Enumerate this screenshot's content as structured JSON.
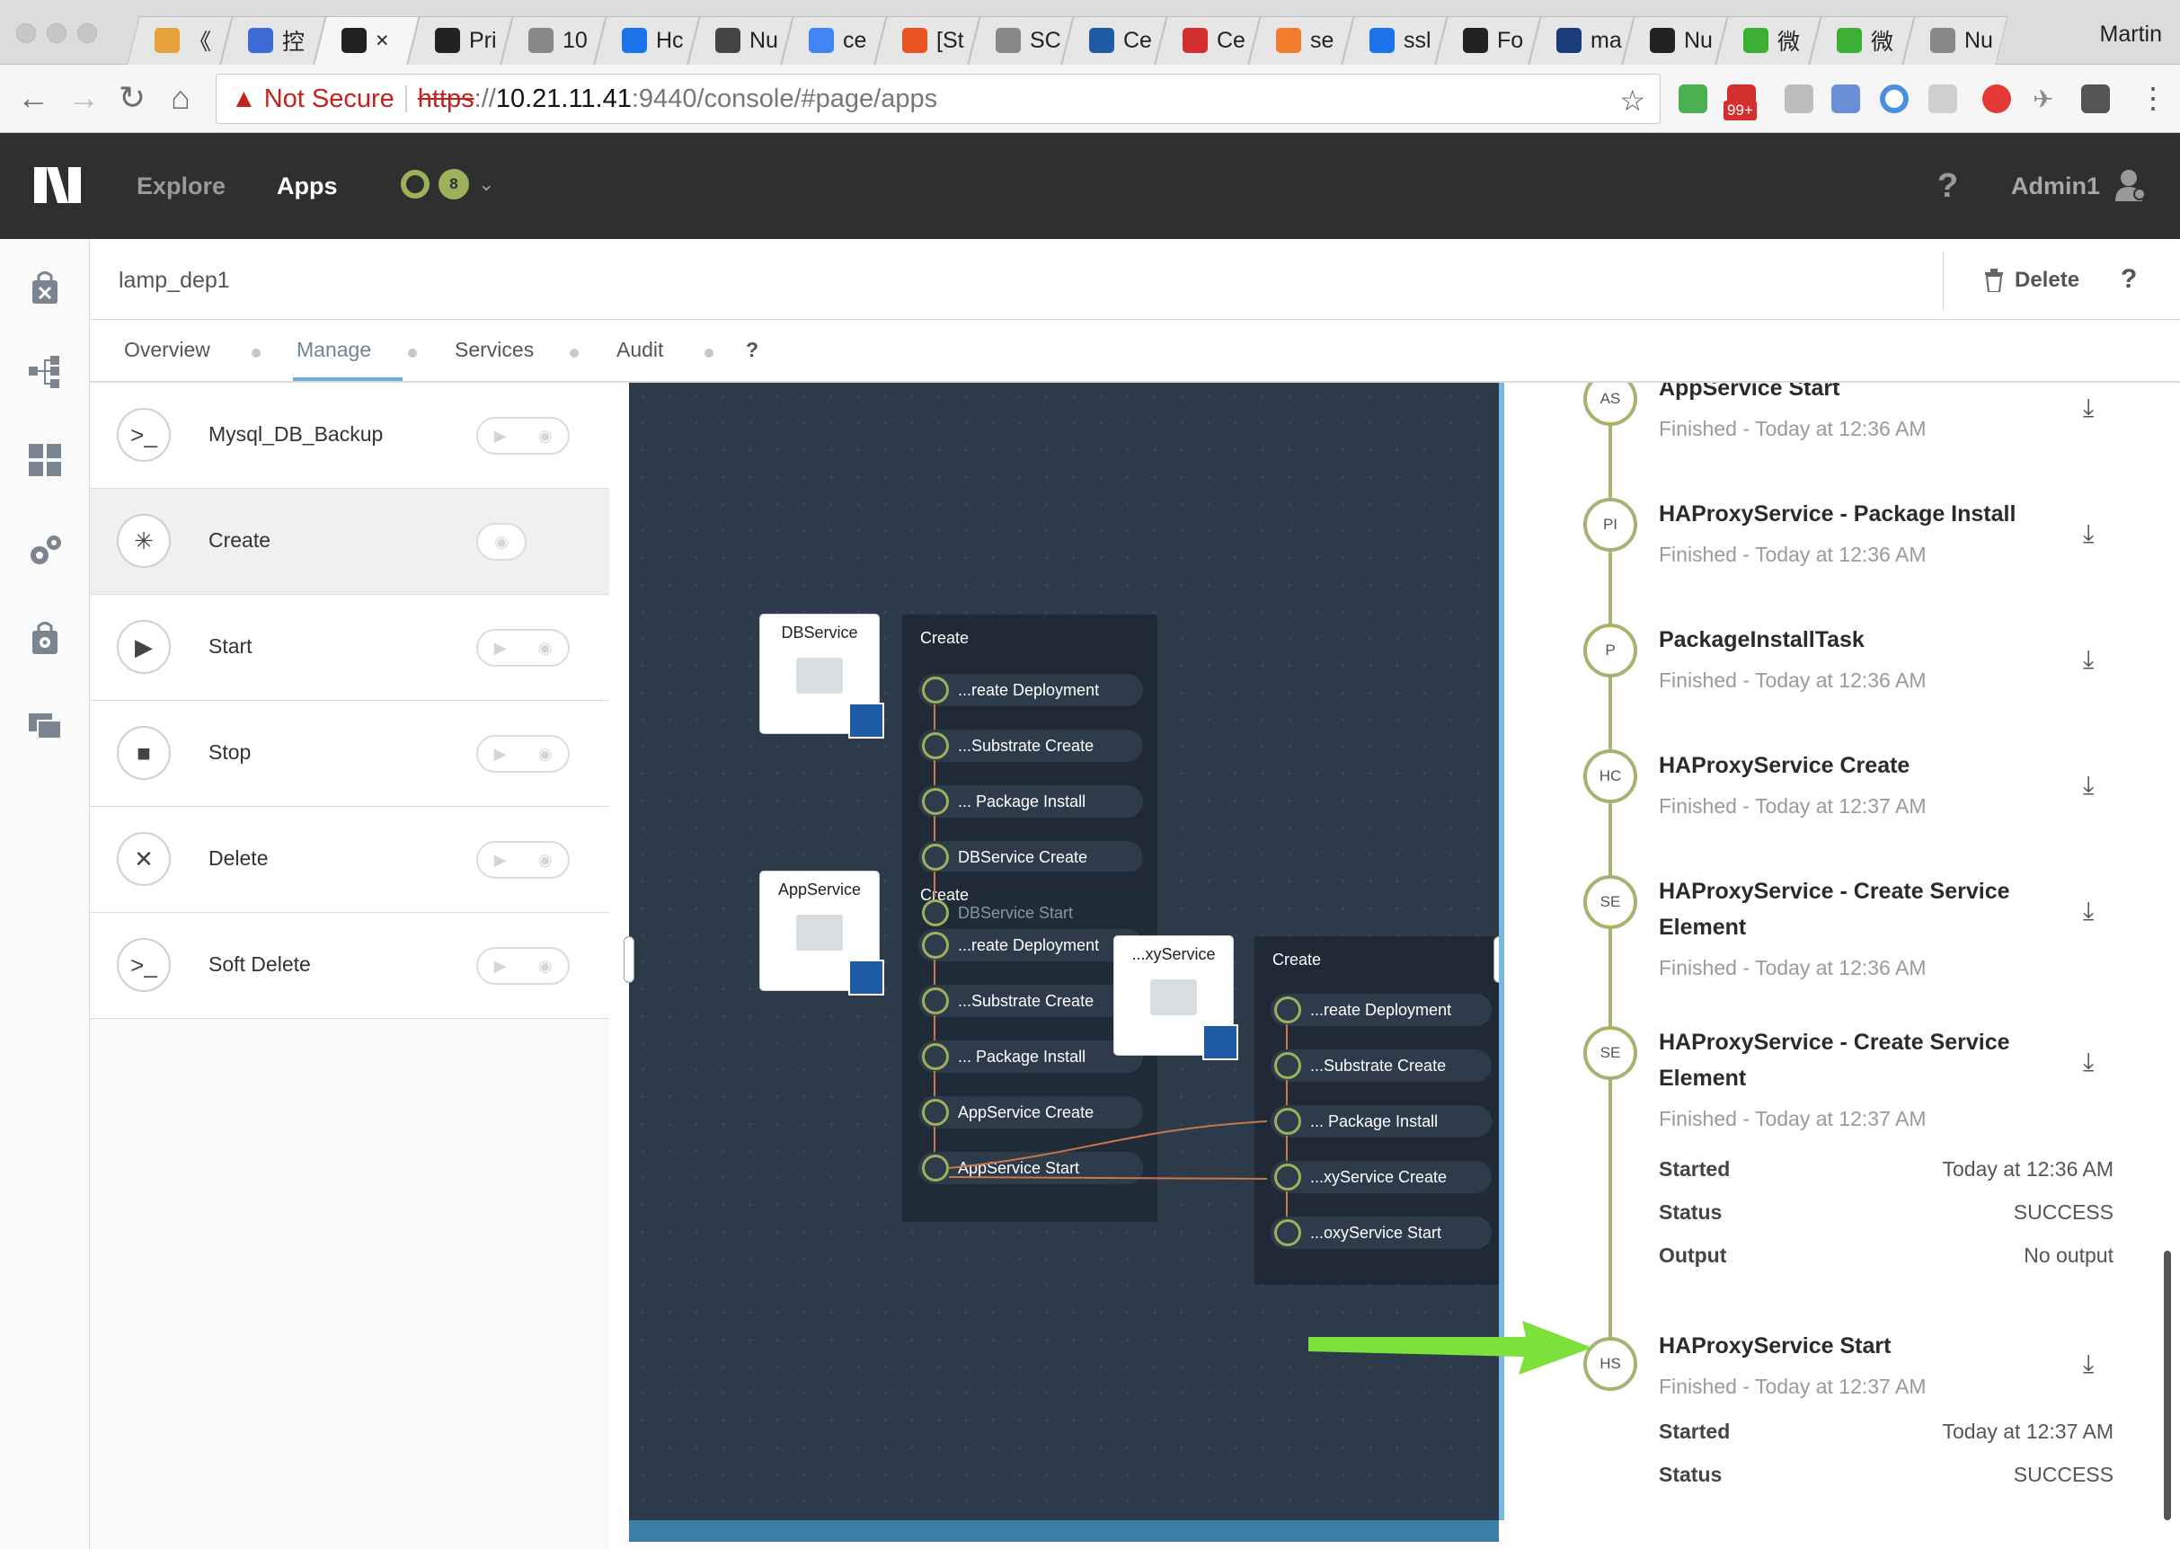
{
  "browser": {
    "tabs": [
      {
        "label": "《",
        "color": "#e7a23b"
      },
      {
        "label": "控",
        "color": "#3d6bd8"
      },
      {
        "label": "×",
        "color": "#222222"
      },
      {
        "label": "Pri",
        "color": "#222222"
      },
      {
        "label": "10",
        "color": "#888888"
      },
      {
        "label": "Hc",
        "color": "#1a73e8"
      },
      {
        "label": "Nu",
        "color": "#444444"
      },
      {
        "label": "ce",
        "color": "#4285f4"
      },
      {
        "label": "[St",
        "color": "#e95420"
      },
      {
        "label": "SC",
        "color": "#888888"
      },
      {
        "label": "Ce",
        "color": "#1f5aa5"
      },
      {
        "label": "Ce",
        "color": "#d32f2f"
      },
      {
        "label": "se",
        "color": "#f07c2c"
      },
      {
        "label": "ssl",
        "color": "#1a73e8"
      },
      {
        "label": "Fo",
        "color": "#222222"
      },
      {
        "label": "ma",
        "color": "#1a3c7a"
      },
      {
        "label": "Nu",
        "color": "#222222"
      },
      {
        "label": "微",
        "color": "#3cb034"
      },
      {
        "label": "微",
        "color": "#3cb034"
      },
      {
        "label": "Nu",
        "color": "#888888"
      }
    ],
    "user": "Martin",
    "security_label": "Not Secure",
    "url_protocol": "https",
    "url_sep": "://",
    "url_host": "10.21.11.41",
    "url_path": ":9440/console/#page/apps",
    "ext_badge": "99+"
  },
  "header": {
    "nav": [
      "Explore",
      "Apps"
    ],
    "alert_count": "8",
    "help": "?",
    "user": "Admin1"
  },
  "page": {
    "app_name": "lamp_dep1",
    "delete_label": "Delete",
    "help": "?",
    "tabs": [
      "Overview",
      "Manage",
      "Services",
      "Audit",
      "?"
    ]
  },
  "actions": [
    {
      "label": "Mysql_DB_Backup",
      "icon": ">_"
    },
    {
      "label": "Create",
      "icon": "✳"
    },
    {
      "label": "Start",
      "icon": "▶"
    },
    {
      "label": "Stop",
      "icon": "■"
    },
    {
      "label": "Delete",
      "icon": "✕"
    },
    {
      "label": "Soft Delete",
      "icon": ">_"
    }
  ],
  "canvas": {
    "services": [
      "DBService",
      "AppService",
      "...xyService"
    ],
    "panels": [
      {
        "title": "Create",
        "tasks": [
          "...reate Deployment",
          "...Substrate Create",
          "... Package Install",
          "DBService Create",
          "DBService Start"
        ]
      },
      {
        "title": "Create",
        "tasks": [
          "...reate Deployment",
          "...Substrate Create",
          "... Package Install",
          "AppService Create",
          "AppService Start"
        ]
      },
      {
        "title": "Create",
        "tasks": [
          "...reate Deployment",
          "...Substrate Create",
          "... Package Install",
          "...xyService Create",
          "...oxyService Start"
        ]
      }
    ]
  },
  "history": {
    "items": [
      {
        "abbr": "AS",
        "title": "AppService Start",
        "sub": "Finished - Today at 12:36 AM"
      },
      {
        "abbr": "PI",
        "title": "HAProxyService - Package Install",
        "sub": "Finished - Today at 12:36 AM"
      },
      {
        "abbr": "P",
        "title": "PackageInstallTask",
        "sub": "Finished - Today at 12:36 AM"
      },
      {
        "abbr": "HC",
        "title": "HAProxyService Create",
        "sub": "Finished - Today at 12:37 AM"
      },
      {
        "abbr": "SE",
        "title_line1": "HAProxyService - Create Service",
        "title_line2": "Element",
        "sub": "Finished - Today at 12:36 AM"
      },
      {
        "abbr": "SE",
        "title_line1": "HAProxyService - Create Service",
        "title_line2": "Element",
        "sub": "Finished - Today at 12:37 AM"
      },
      {
        "abbr": "HS",
        "title": "HAProxyService Start",
        "sub": "Finished - Today at 12:37 AM"
      }
    ],
    "details_1": {
      "started_label": "Started",
      "started": "Today at 12:36 AM",
      "status_label": "Status",
      "status": "SUCCESS",
      "output_label": "Output",
      "output": "No output"
    },
    "details_2": {
      "started_label": "Started",
      "started": "Today at 12:37 AM",
      "status_label": "Status",
      "status": "SUCCESS"
    }
  },
  "colors": {
    "header_bg": "#2f2f2f",
    "accent_green": "#9db05a",
    "canvas_bg": "#2d3a49",
    "annotation_arrow": "#7ee03a"
  }
}
